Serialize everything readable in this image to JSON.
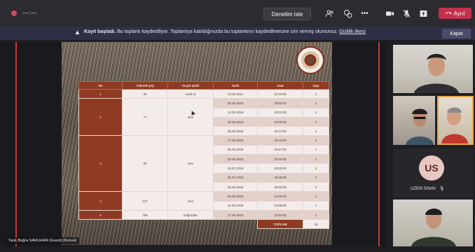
{
  "topbar": {
    "call_time": "—:—",
    "denetim_label": "Denetim iste",
    "leave_label": "Ayrıl",
    "icons": [
      "participants-icon",
      "reactions-icon",
      "more-icon",
      "camera-icon",
      "mic-off-icon",
      "share-icon"
    ]
  },
  "banner": {
    "title": "Kayıt başladı.",
    "message": "Bu toplantı kaydediliyor. Toplantıya katıldığınızda bu toplantının kaydedilmesine izin vermiş olursunuz.",
    "privacy_link": "Gizlilik ilkesi",
    "close_label": "Kapat"
  },
  "table": {
    "headers": [
      "No",
      "Yükselti (m)",
      "Tespit Şekli",
      "Tarih",
      "Saat",
      "Sayı"
    ],
    "groups": [
      {
        "no": "1",
        "elev": "40",
        "method": "Ayak izi",
        "rows": [
          [
            "23.02.2011",
            "12:15:00",
            "1"
          ]
        ]
      },
      {
        "no": "2",
        "elev": "77",
        "method": "Ses",
        "rows": [
          [
            "25.05.2018",
            "19:50:00",
            "1"
          ],
          [
            "13.06.2018",
            "20:02:00",
            "1"
          ],
          [
            "29.06.2018",
            "20:05:00",
            "1"
          ],
          [
            "25.08.2018",
            "19:13:00",
            "1"
          ]
        ]
      },
      {
        "no": "3",
        "elev": "92",
        "method": "Ses",
        "rows": [
          [
            "17.05.2018",
            "19:43:00",
            "2"
          ],
          [
            "05.06.2018",
            "19:57:00",
            "1"
          ],
          [
            "20.06.2018",
            "20:00:00",
            "1"
          ],
          [
            "15.07.2018",
            "20:00:00",
            "2"
          ],
          [
            "30.07.2018",
            "19:48:00",
            "1"
          ],
          [
            "03.09.2018",
            "18:59:00",
            "2"
          ]
        ]
      },
      {
        "no": "4",
        "elev": "137",
        "method": "Ses",
        "rows": [
          [
            "04.08.2018",
            "12:09:00",
            "1"
          ],
          [
            "11.08.2018",
            "12:08:00",
            "1"
          ]
        ]
      },
      {
        "no": "5",
        "elev": "798",
        "method": "Doğrudan",
        "rows": [
          [
            "27.06.2018",
            "15:50:00",
            "1"
          ]
        ]
      }
    ],
    "total_label": "TOPLAM",
    "total_value": "16"
  },
  "presenter_label": "Tarık Buğra SARUHAN (Guest) (Konuk)",
  "participants": {
    "us_initials": "US",
    "us_name": "UZEM SINAV"
  }
}
